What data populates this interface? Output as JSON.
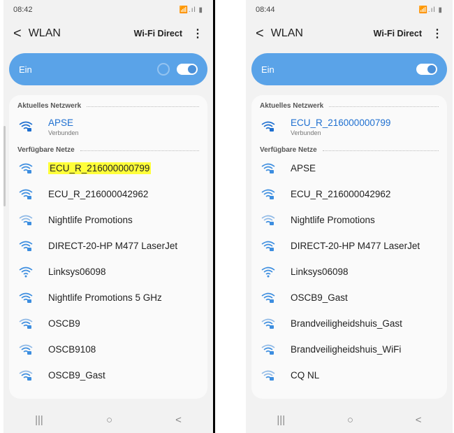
{
  "left": {
    "time": "08:42",
    "status_right": "📶.ıl ▮",
    "title": "WLAN",
    "wifi_direct": "Wi-Fi Direct",
    "toggle_label": "Ein",
    "current_header": "Aktuelles Netzwerk",
    "current_name": "APSE",
    "current_status": "Verbunden",
    "available_header": "Verfügbare Netze",
    "networks": [
      "ECU_R_216000000799",
      "ECU_R_216000042962",
      "Nightlife Promotions",
      "DIRECT-20-HP M477 LaserJet",
      "Linksys06098",
      "Nightlife Promotions 5 GHz",
      "OSCB9",
      "OSCB9108",
      "OSCB9_Gast"
    ]
  },
  "right": {
    "time": "08:44",
    "status_right": "📶.ıl ▮",
    "title": "WLAN",
    "wifi_direct": "Wi-Fi Direct",
    "toggle_label": "Ein",
    "current_header": "Aktuelles Netzwerk",
    "current_name": "ECU_R_216000000799",
    "current_status": "Verbunden",
    "available_header": "Verfügbare Netze",
    "networks": [
      "APSE",
      "ECU_R_216000042962",
      "Nightlife Promotions",
      "DIRECT-20-HP M477 LaserJet",
      "Linksys06098",
      "OSCB9_Gast",
      "Brandveiligheidshuis_Gast",
      "Brandveiligheidshuis_WiFi",
      "CQ NL"
    ]
  },
  "nav": {
    "recents": "|||",
    "home": "○",
    "back": "<"
  },
  "colors": {
    "toggle": "#5aa3e8",
    "link": "#1e6fd0",
    "highlight": "#ffff3a"
  }
}
